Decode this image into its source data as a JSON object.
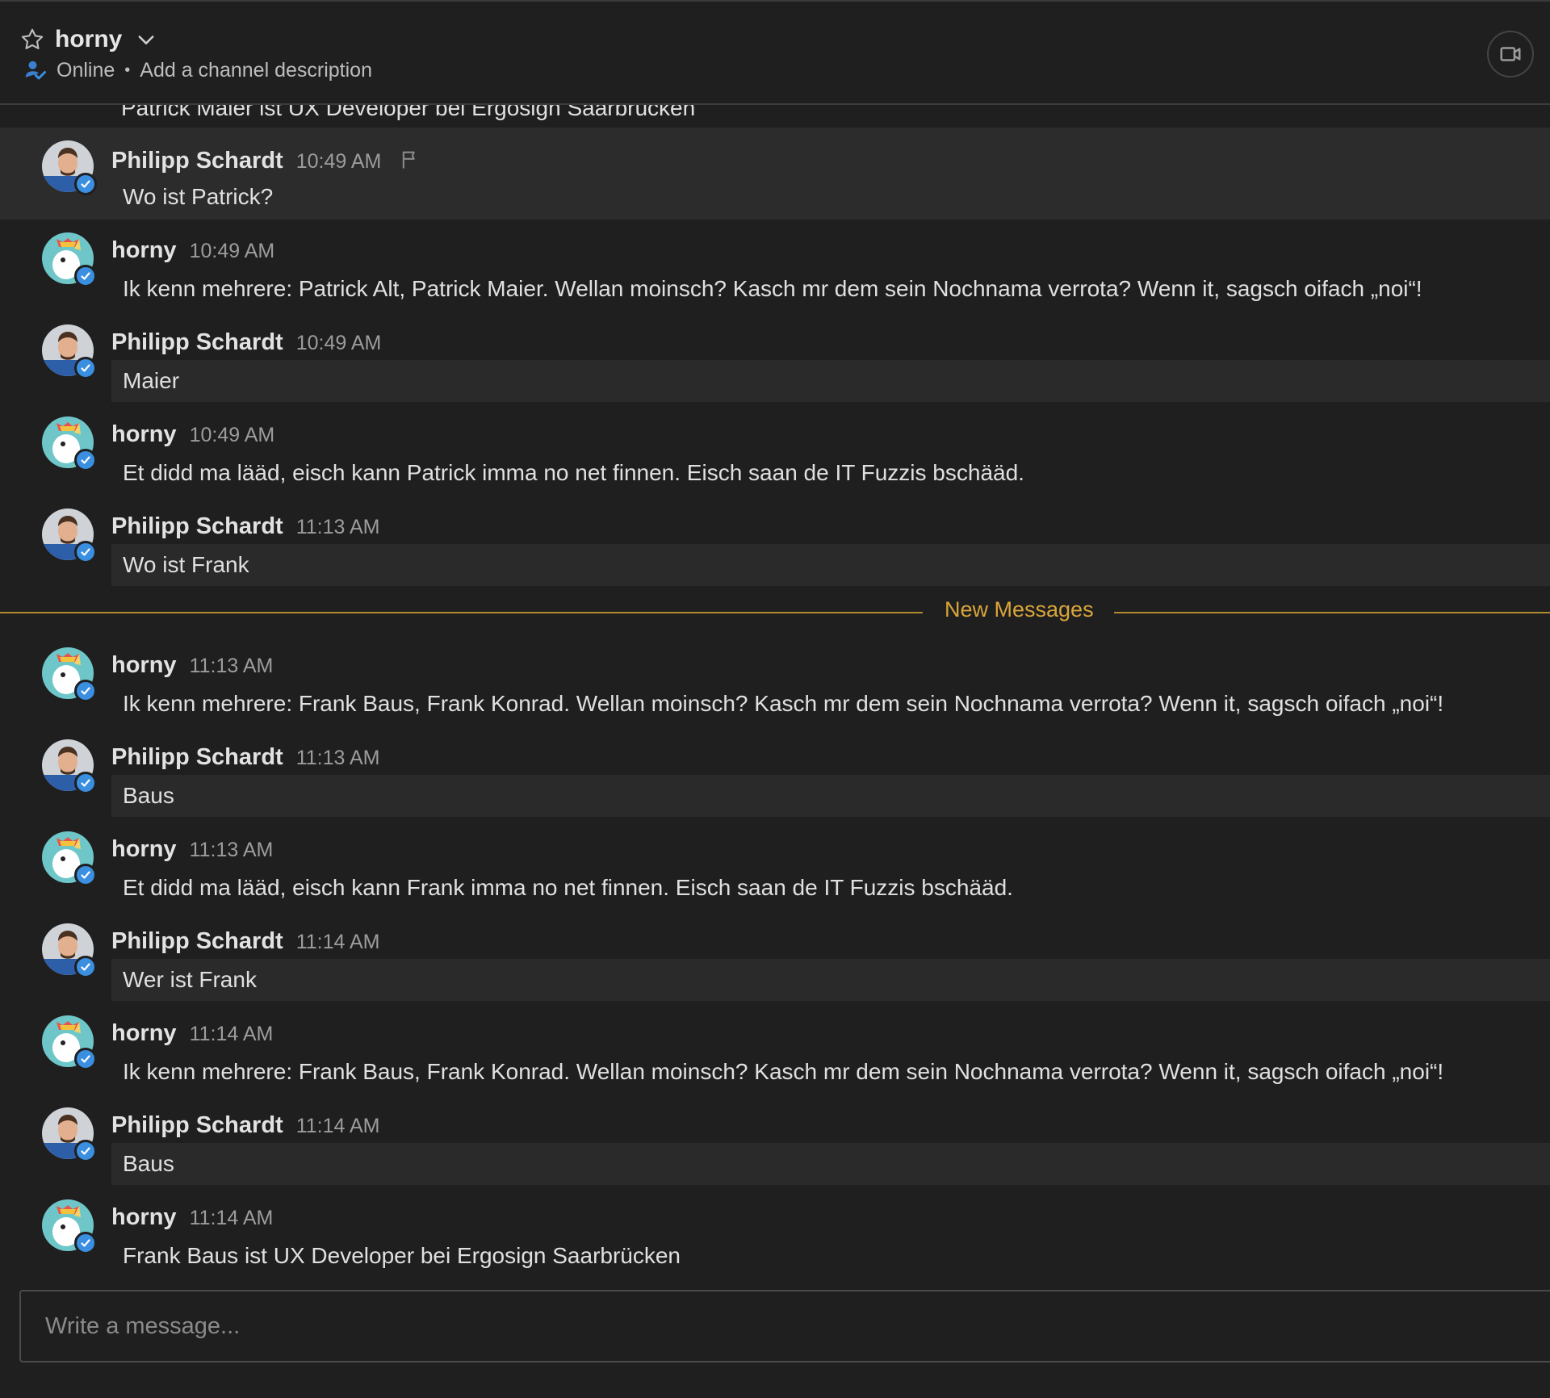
{
  "header": {
    "channel_name": "horny",
    "status": "Online",
    "description_link": "Add a channel description"
  },
  "messages": {
    "cutoff_text": "Patrick Maier ist UX Developer bei Ergosign Saarbrücken",
    "items": [
      {
        "author": "Philipp Schardt",
        "time": "10:49 AM",
        "text": "Wo ist Patrick?"
      },
      {
        "author": "horny",
        "time": "10:49 AM",
        "text": "Ik kenn mehrere: Patrick Alt, Patrick Maier. Wellan moinsch? Kasch mr dem sein Nochnama verrota? Wenn it, sagsch oifach „noi“!"
      },
      {
        "author": "Philipp Schardt",
        "time": "10:49 AM",
        "text": "Maier"
      },
      {
        "author": "horny",
        "time": "10:49 AM",
        "text": "Et didd ma lääd, eisch kann Patrick imma no net finnen. Eisch saan de IT Fuzzis bschääd."
      },
      {
        "author": "Philipp Schardt",
        "time": "11:13 AM",
        "text": "Wo ist Frank"
      },
      {
        "author": "horny",
        "time": "11:13 AM",
        "text": "Ik kenn mehrere: Frank Baus, Frank Konrad. Wellan moinsch? Kasch mr dem sein Nochnama verrota? Wenn it, sagsch oifach „noi“!"
      },
      {
        "author": "Philipp Schardt",
        "time": "11:13 AM",
        "text": "Baus"
      },
      {
        "author": "horny",
        "time": "11:13 AM",
        "text": "Et didd ma lääd, eisch kann Frank imma no net finnen. Eisch saan de IT Fuzzis bschääd."
      },
      {
        "author": "Philipp Schardt",
        "time": "11:14 AM",
        "text": "Wer ist Frank"
      },
      {
        "author": "horny",
        "time": "11:14 AM",
        "text": "Ik kenn mehrere: Frank Baus, Frank Konrad. Wellan moinsch? Kasch mr dem sein Nochnama verrota? Wenn it, sagsch oifach „noi“!"
      },
      {
        "author": "Philipp Schardt",
        "time": "11:14 AM",
        "text": "Baus"
      },
      {
        "author": "horny",
        "time": "11:14 AM",
        "text": "Frank Baus ist UX Developer bei Ergosign Saarbrücken"
      }
    ],
    "new_messages_label": "New Messages"
  },
  "composer": {
    "placeholder": "Write a message..."
  },
  "colors": {
    "background": "#1f1f20",
    "accent_new_messages": "#d9a53a",
    "verified_badge": "#3a8fe0"
  },
  "icons": [
    "star-icon",
    "chevron-down-icon",
    "online-status-icon",
    "video-call-icon",
    "flag-icon",
    "verified-badge-icon"
  ]
}
